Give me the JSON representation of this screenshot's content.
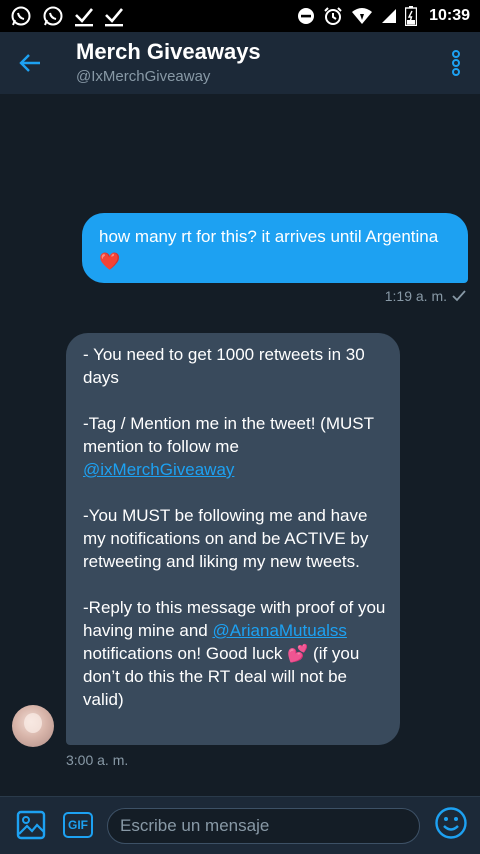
{
  "status_bar": {
    "time": "10:39"
  },
  "header": {
    "title": "Merch Giveaways",
    "handle": "@IxMerchGiveaway"
  },
  "outgoing": {
    "text": "how many rt for this? it arrives until Argentina",
    "emoji": "❤️",
    "time": "1:19 a. m."
  },
  "incoming": {
    "p1": "- You need to get 1000 retweets in 30 days",
    "p2_text": "-Tag / Mention me in the tweet! (MUST mention to follow me",
    "p2_mention": "@ixMerchGiveaway",
    "p3": "-You MUST be following me and have my notifications on and be ACTIVE by retweeting and liking my new tweets.",
    "p4_start": "-Reply to this message with proof of you having mine and",
    "p4_mention": "@ArianaMutualss",
    "p4_mid": "notifications on! Good luck",
    "p4_emoji": "💕",
    "p4_end": "(if you don’t do this the RT deal will not be valid)",
    "time": "3:00 a. m."
  },
  "composer": {
    "placeholder": "Escribe un mensaje",
    "gif_label": "GIF"
  },
  "colors": {
    "accent": "#1da1f2",
    "background": "#141d26",
    "bar": "#1c2938",
    "incoming_bubble": "#394a5c"
  }
}
